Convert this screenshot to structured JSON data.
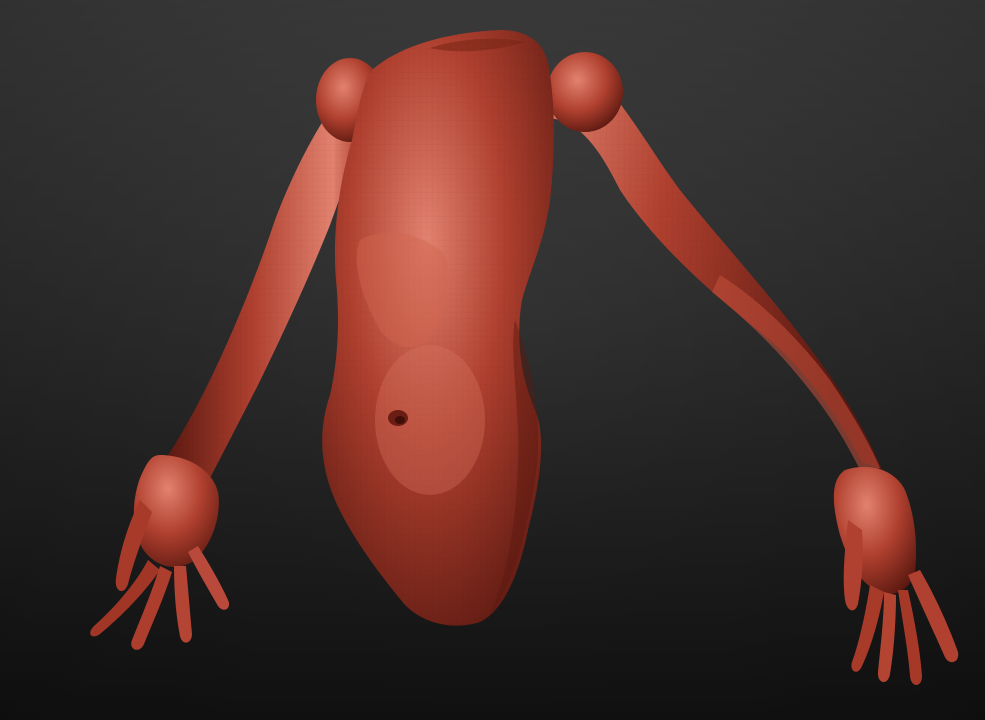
{
  "scene": {
    "subject_icon": "sculpt-torso-with-arms",
    "colors": {
      "background_top": "#474747",
      "background_bottom": "#161616",
      "clay_highlight": "#e2826f",
      "clay_base": "#b0402f",
      "clay_shadow": "#5a1810"
    }
  }
}
